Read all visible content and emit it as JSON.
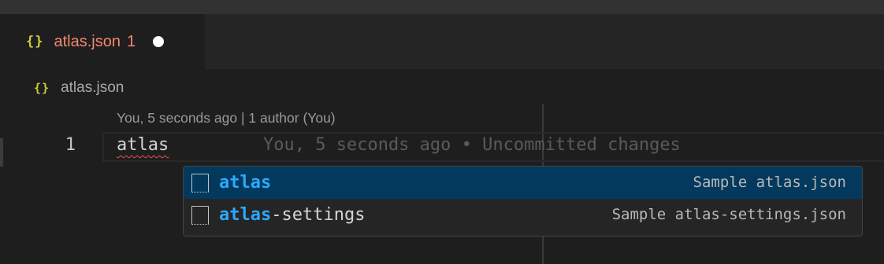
{
  "tab": {
    "icon": "{}",
    "name": "atlas.json",
    "problems": "1"
  },
  "breadcrumb": {
    "icon": "{}",
    "label": "atlas.json"
  },
  "editor": {
    "codelens": "You, 5 seconds ago | 1 author (You)",
    "line_number": "1",
    "code": "atlas",
    "blame": "You, 5 seconds ago • Uncommitted changes"
  },
  "suggestions": [
    {
      "match": "atlas",
      "rest": "",
      "detail": "Sample atlas.json"
    },
    {
      "match": "atlas",
      "rest": "-settings",
      "detail": "Sample atlas-settings.json"
    }
  ],
  "icons": {
    "file_icon": "json-braces-icon",
    "dirty": "unsaved-dot-icon",
    "suggestion_kind": "snippet-icon"
  },
  "colors": {
    "tab_error": "#f48771",
    "braces": "#cbcb41",
    "match_highlight": "#2aaaff",
    "selection": "#04395e"
  }
}
